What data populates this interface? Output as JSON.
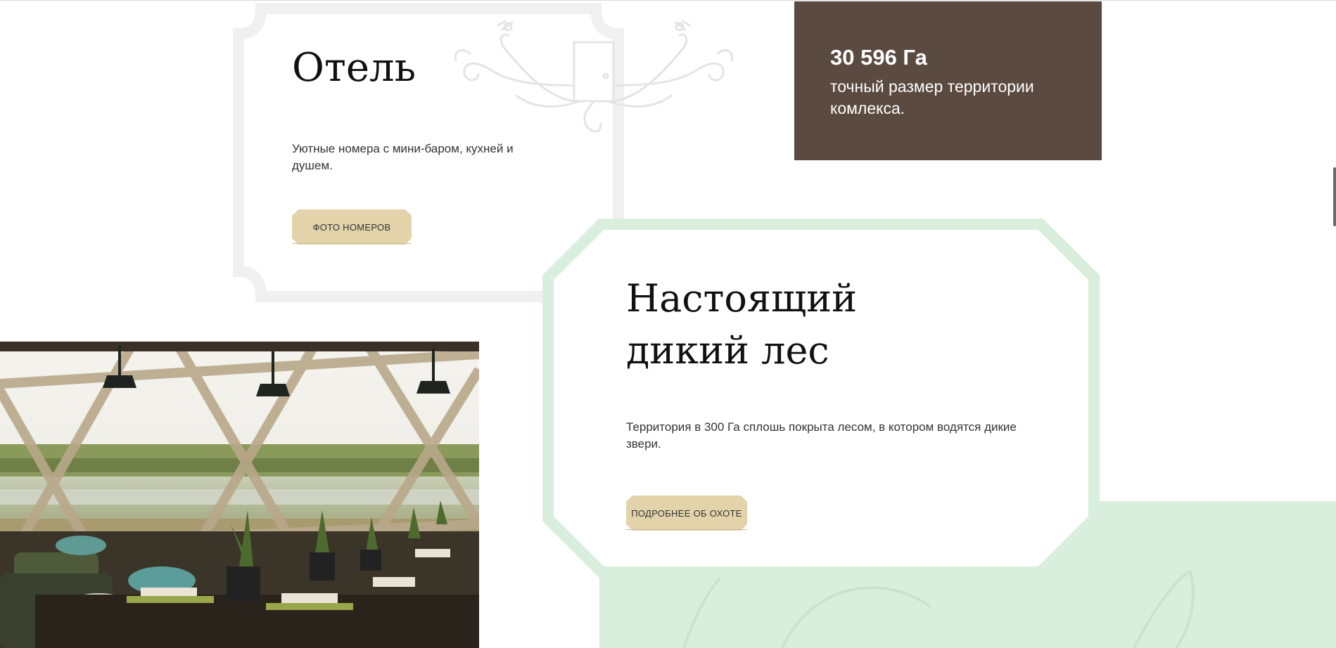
{
  "hotel": {
    "title": "Отель",
    "description": "Уютные номера с мини-баром, кухней и душем.",
    "button_label": "ФОТО НОМЕРОВ"
  },
  "stat": {
    "number": "30 596 Га",
    "label": "точный размер территории комлекса."
  },
  "forest": {
    "title": "Настоящий дикий лес",
    "description": "Территория в 300 Га сплошь покрыта лесом, в котором водятся дикие звери.",
    "button_label": "ПОДРОБНЕЕ ОБ ОХОТЕ"
  },
  "colors": {
    "stat_bg": "#5b4a40",
    "button_bg": "#e2d3aa",
    "green_frame": "#d9eedc",
    "grey_frame": "#f1f1f1"
  },
  "icons": [
    "door-ornament-icon"
  ]
}
